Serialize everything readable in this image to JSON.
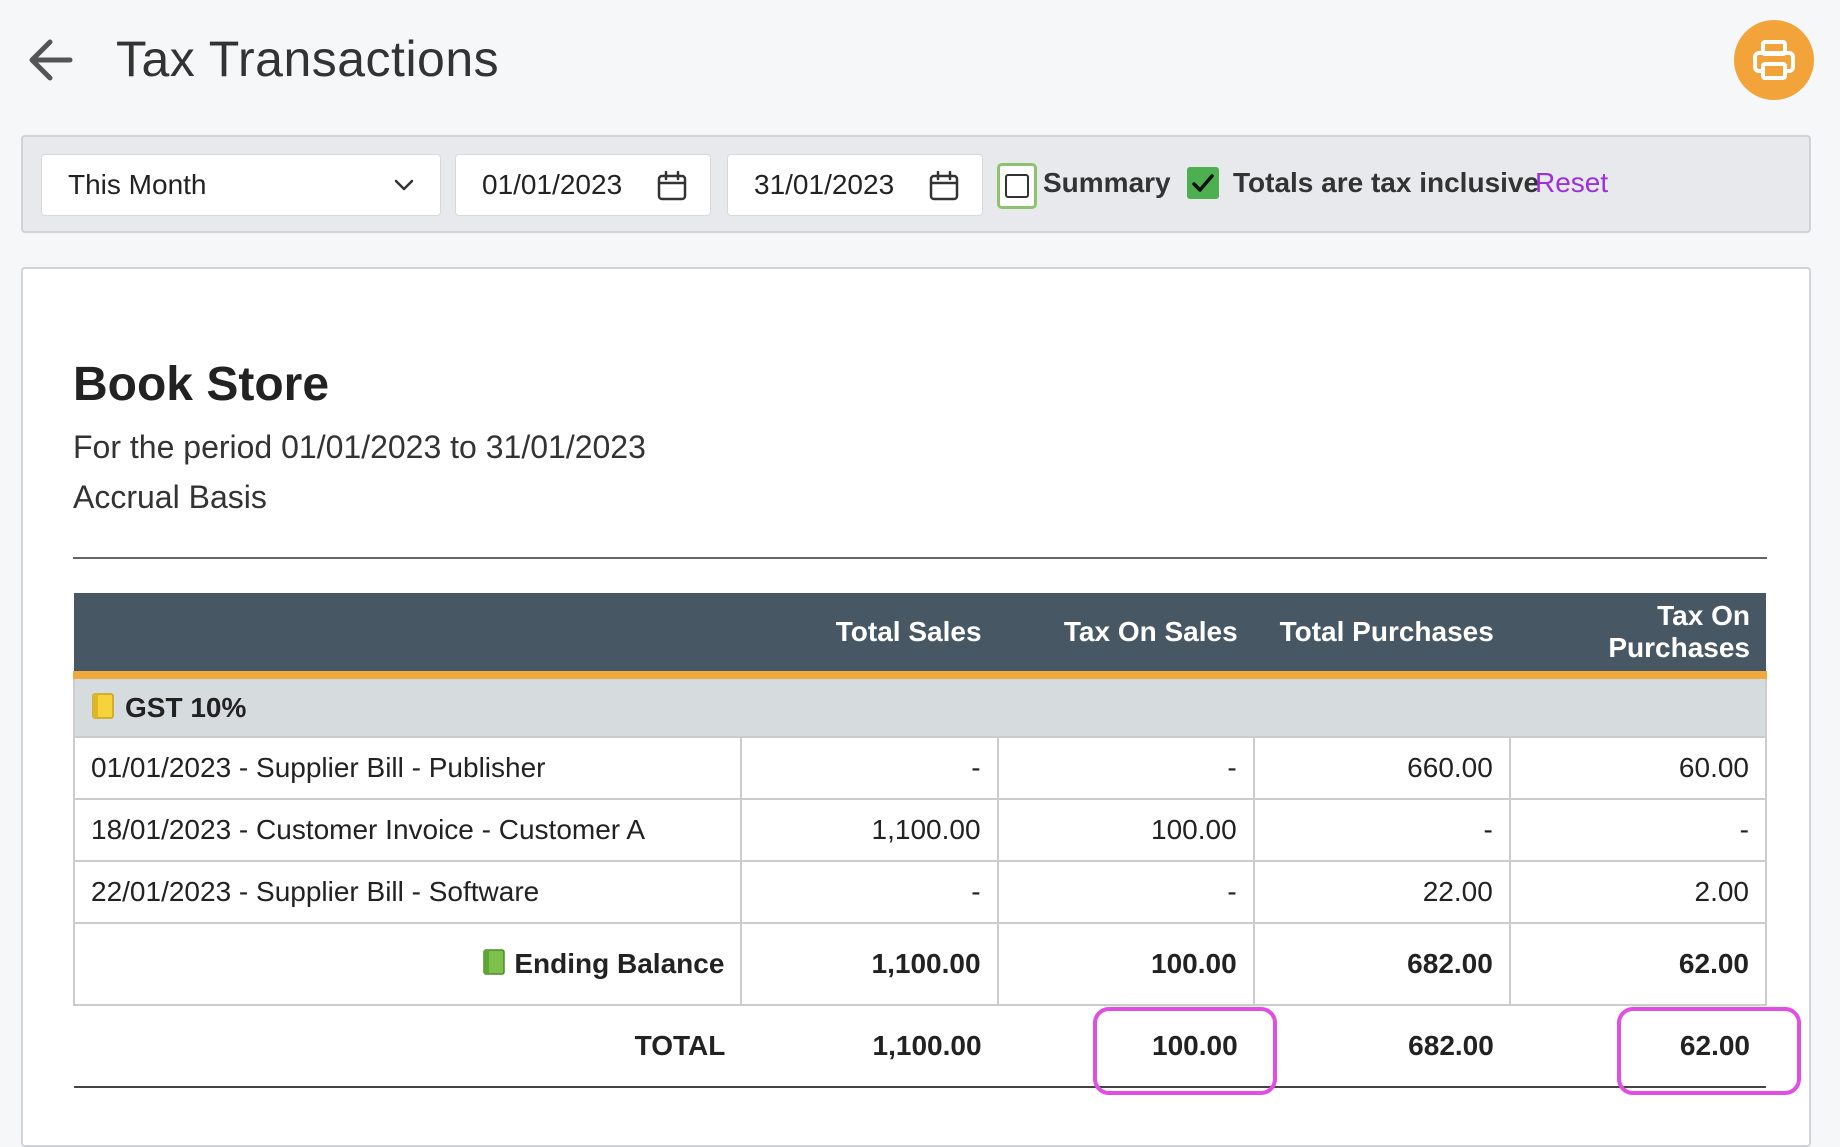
{
  "header": {
    "title": "Tax Transactions",
    "back_icon": "arrow-left-icon",
    "print_icon": "printer-icon",
    "print_color": "#f2a43a"
  },
  "filters": {
    "period": "This Month",
    "start_date": "01/01/2023",
    "end_date": "31/01/2023",
    "summary_label": "Summary",
    "summary_checked": false,
    "tax_inclusive_label": "Totals are tax inclusive",
    "tax_inclusive_checked": true,
    "reset_label": "Reset",
    "reset_color": "#9b30e0"
  },
  "report": {
    "company": "Book Store",
    "period_text": "For the period 01/01/2023 to 31/01/2023",
    "basis": "Accrual Basis",
    "columns": [
      "",
      "Total Sales",
      "Tax On Sales",
      "Total Purchases",
      "Tax On Purchases"
    ],
    "group": {
      "icon": "yellow-tag-icon",
      "name": "GST 10%"
    },
    "rows": [
      {
        "description": "01/01/2023 - Supplier Bill - Publisher",
        "total_sales": "-",
        "tax_on_sales": "-",
        "total_purchases": "660.00",
        "tax_on_purchases": "60.00"
      },
      {
        "description": "18/01/2023 - Customer Invoice - Customer A",
        "total_sales": "1,100.00",
        "tax_on_sales": "100.00",
        "total_purchases": "-",
        "tax_on_purchases": "-"
      },
      {
        "description": "22/01/2023 - Supplier Bill - Software",
        "total_sales": "-",
        "tax_on_sales": "-",
        "total_purchases": "22.00",
        "tax_on_purchases": "2.00"
      }
    ],
    "ending_balance": {
      "icon": "green-book-icon",
      "label": "Ending Balance",
      "total_sales": "1,100.00",
      "tax_on_sales": "100.00",
      "total_purchases": "682.00",
      "tax_on_purchases": "62.00"
    },
    "total": {
      "label": "TOTAL",
      "total_sales": "1,100.00",
      "tax_on_sales": "100.00",
      "total_purchases": "682.00",
      "tax_on_purchases": "62.00"
    },
    "header_bg": "#475864",
    "header_underline": "#efa93c",
    "highlight_color": "#e24ee2"
  }
}
